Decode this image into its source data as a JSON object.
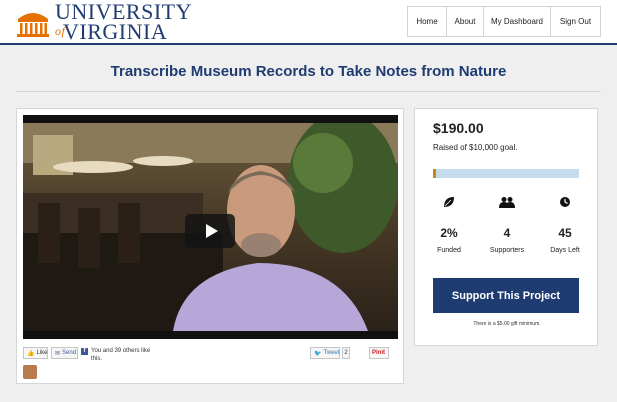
{
  "header": {
    "logo": {
      "line1": "UNIVERSITY",
      "of": "of",
      "line2": "VIRGINIA",
      "brand_color": "#1f3c72",
      "accent_color": "#e57200"
    },
    "nav": [
      {
        "label": "Home"
      },
      {
        "label": "About"
      },
      {
        "label": "My Dashboard"
      },
      {
        "label": "Sign Out"
      }
    ]
  },
  "page": {
    "title": "Transcribe Museum Records to Take Notes from Nature"
  },
  "video": {
    "icon": "play-icon"
  },
  "social": {
    "like": "Like",
    "send": "Send",
    "fb_text": "You and 39 others like this.",
    "tweet": "Tweet",
    "tweet_count": "2",
    "pinit": "Pinit"
  },
  "campaign": {
    "amount": "$190.00",
    "raised_text": "Raised of $10,000 goal.",
    "progress_fraction": 0.019,
    "stats": [
      {
        "icon": "leaf-icon",
        "value": "2%",
        "label": "Funded"
      },
      {
        "icon": "people-icon",
        "value": "4",
        "label": "Supporters"
      },
      {
        "icon": "clock-icon",
        "value": "45",
        "label": "Days Left"
      }
    ],
    "support_label": "Support This Project",
    "min_note": "There is a $5.00 gift minimum."
  }
}
